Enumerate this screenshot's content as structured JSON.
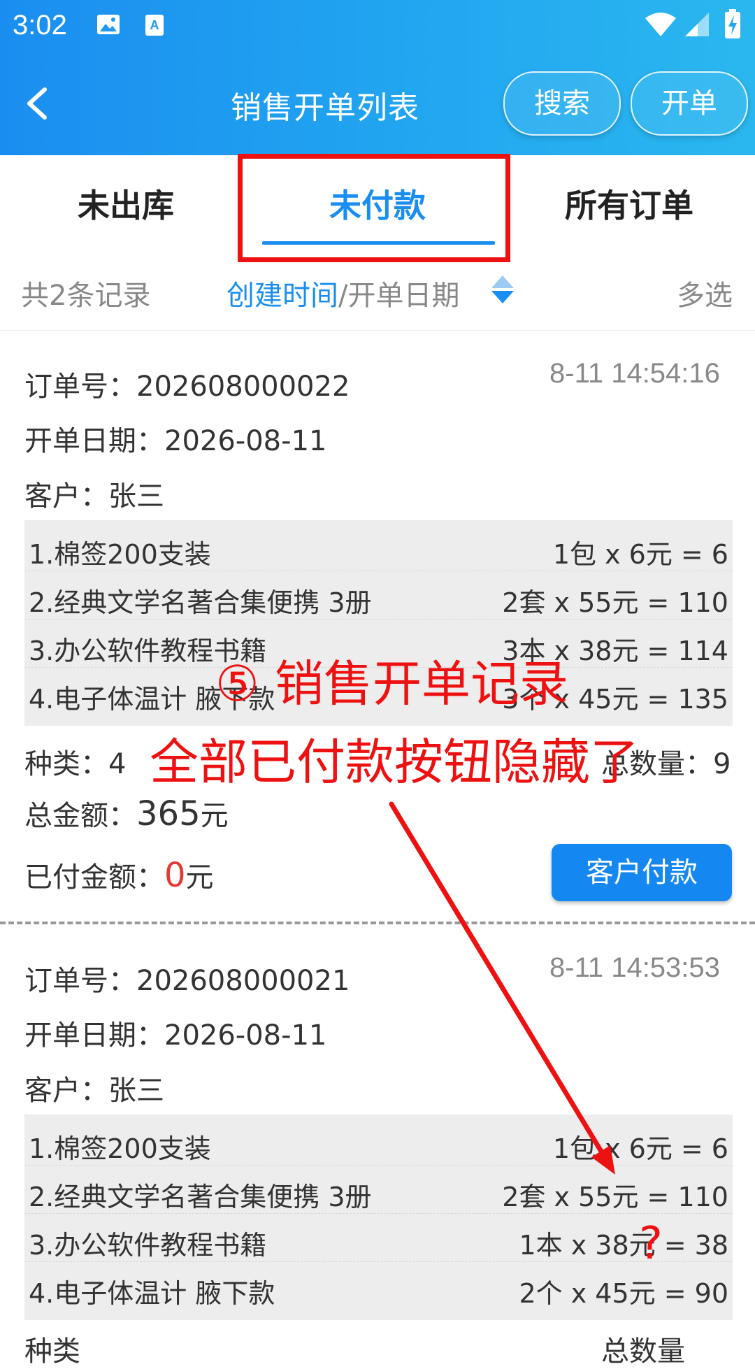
{
  "status_bar": {
    "time": "3:02"
  },
  "header": {
    "title": "销售开单列表",
    "search_label": "搜索",
    "create_label": "开单"
  },
  "tabs": [
    {
      "label": "未出库"
    },
    {
      "label": "未付款"
    },
    {
      "label": "所有订单"
    }
  ],
  "filter": {
    "count_text": "共2条记录",
    "sort_primary": "创建时间",
    "sort_sep": "/",
    "sort_secondary": "开单日期",
    "multi_select": "多选"
  },
  "orders": [
    {
      "order_label": "订单号：",
      "order_no": "202608000022",
      "created": "8-11 14:54:16",
      "date_label": "开单日期：",
      "date": "2026-08-11",
      "customer_label": "客户：",
      "customer": "张三",
      "items": [
        {
          "name": "1.棉签200支装",
          "calc": "1包 x 6元 = 6"
        },
        {
          "name": "2.经典文学名著合集便携 3册",
          "calc": "2套 x 55元 = 110"
        },
        {
          "name": "3.办公软件教程书籍",
          "calc": "3本 x 38元 = 114"
        },
        {
          "name": "4.电子体温计 腋下款",
          "calc": "3个 x 45元 = 135"
        }
      ],
      "kinds_label": "种类：",
      "kinds": "4",
      "qty_label": "总数量：",
      "qty": "9",
      "total_label": "总金额：",
      "total": "365",
      "paid_label": "已付金额：",
      "paid": "0",
      "unit": "元",
      "pay_button": "客户付款"
    },
    {
      "order_label": "订单号：",
      "order_no": "202608000021",
      "created": "8-11 14:53:53",
      "date_label": "开单日期：",
      "date": "2026-08-11",
      "customer_label": "客户：",
      "customer": "张三",
      "items": [
        {
          "name": "1.棉签200支装",
          "calc": "1包 x 6元 = 6"
        },
        {
          "name": "2.经典文学名著合集便携 3册",
          "calc": "2套 x 55元 = 110"
        },
        {
          "name": "3.办公软件教程书籍",
          "calc": "1本 x 38元 = 38"
        },
        {
          "name": "4.电子体温计 腋下款",
          "calc": "2个 x 45元 = 90"
        }
      ],
      "kinds_label": "种类",
      "qty_label": "总数量"
    }
  ],
  "annotations": {
    "step": "⑤ 销售开单记录",
    "note": "全部已付款按钮隐藏了",
    "question": "?",
    "color": "#ee1111"
  },
  "icons": [
    "image-icon",
    "font-app-icon",
    "wifi-icon",
    "signal-icon",
    "battery-charging-icon",
    "back-arrow-icon",
    "sort-toggle-icon"
  ]
}
